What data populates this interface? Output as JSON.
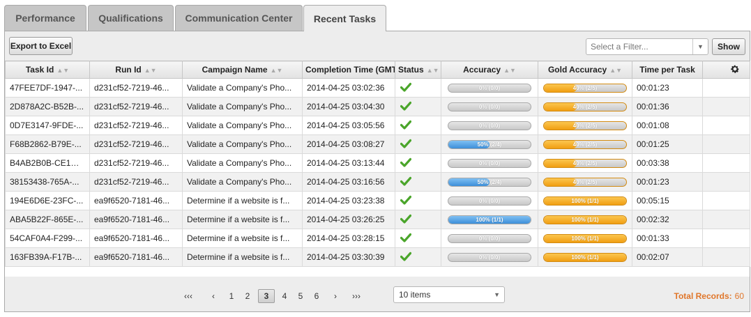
{
  "tabs": [
    {
      "label": "Performance"
    },
    {
      "label": "Qualifications"
    },
    {
      "label": "Communication Center"
    },
    {
      "label": "Recent Tasks"
    }
  ],
  "toolbar": {
    "export_label": "Export to Excel",
    "filter_placeholder": "Select a Filter...",
    "show_label": "Show"
  },
  "columns": [
    "Task Id",
    "Run Id",
    "Campaign Name",
    "Completion Time (GMT)",
    "Status",
    "Accuracy",
    "Gold Accuracy",
    "Time per Task"
  ],
  "rows": [
    {
      "task_id": "47FEE7DF-1947-...",
      "run_id": "d231cf52-7219-46...",
      "campaign": "Validate a Company's Pho...",
      "time": "2014-04-25 03:02:36",
      "acc": "0% (0/0)",
      "acc_pct": 0,
      "gold": "40% (2/5)",
      "gold_pct": 40,
      "tpt": "00:01:23"
    },
    {
      "task_id": "2D878A2C-B52B-...",
      "run_id": "d231cf52-7219-46...",
      "campaign": "Validate a Company's Pho...",
      "time": "2014-04-25 03:04:30",
      "acc": "0% (0/0)",
      "acc_pct": 0,
      "gold": "40% (2/5)",
      "gold_pct": 40,
      "tpt": "00:01:36"
    },
    {
      "task_id": "0D7E3147-9FDE-...",
      "run_id": "d231cf52-7219-46...",
      "campaign": "Validate a Company's Pho...",
      "time": "2014-04-25 03:05:56",
      "acc": "0% (0/0)",
      "acc_pct": 0,
      "gold": "40% (2/5)",
      "gold_pct": 40,
      "tpt": "00:01:08"
    },
    {
      "task_id": "F68B2862-B79E-...",
      "run_id": "d231cf52-7219-46...",
      "campaign": "Validate a Company's Pho...",
      "time": "2014-04-25 03:08:27",
      "acc": "50% (2/4)",
      "acc_pct": 50,
      "gold": "40% (2/5)",
      "gold_pct": 40,
      "tpt": "00:01:25"
    },
    {
      "task_id": "B4AB2B0B-CE1D-...",
      "run_id": "d231cf52-7219-46...",
      "campaign": "Validate a Company's Pho...",
      "time": "2014-04-25 03:13:44",
      "acc": "0% (0/0)",
      "acc_pct": 0,
      "gold": "40% (2/5)",
      "gold_pct": 40,
      "tpt": "00:03:38"
    },
    {
      "task_id": "38153438-765A-...",
      "run_id": "d231cf52-7219-46...",
      "campaign": "Validate a Company's Pho...",
      "time": "2014-04-25 03:16:56",
      "acc": "50% (2/4)",
      "acc_pct": 50,
      "gold": "40% (2/5)",
      "gold_pct": 40,
      "tpt": "00:01:23"
    },
    {
      "task_id": "194E6D6E-23FC-...",
      "run_id": "ea9f6520-7181-46...",
      "campaign": "Determine if a website is f...",
      "time": "2014-04-25 03:23:38",
      "acc": "0% (0/0)",
      "acc_pct": 0,
      "gold": "100% (1/1)",
      "gold_pct": 100,
      "tpt": "00:05:15"
    },
    {
      "task_id": "ABA5B22F-865E-...",
      "run_id": "ea9f6520-7181-46...",
      "campaign": "Determine if a website is f...",
      "time": "2014-04-25 03:26:25",
      "acc": "100% (1/1)",
      "acc_pct": 100,
      "gold": "100% (1/1)",
      "gold_pct": 100,
      "tpt": "00:02:32"
    },
    {
      "task_id": "54CAF0A4-F299-...",
      "run_id": "ea9f6520-7181-46...",
      "campaign": "Determine if a website is f...",
      "time": "2014-04-25 03:28:15",
      "acc": "0% (0/0)",
      "acc_pct": 0,
      "gold": "100% (1/1)",
      "gold_pct": 100,
      "tpt": "00:01:33"
    },
    {
      "task_id": "163FB39A-F17B-...",
      "run_id": "ea9f6520-7181-46...",
      "campaign": "Determine if a website is f...",
      "time": "2014-04-25 03:30:39",
      "acc": "0% (0/0)",
      "acc_pct": 0,
      "gold": "100% (1/1)",
      "gold_pct": 100,
      "tpt": "00:02:07"
    }
  ],
  "pager": {
    "first": "‹‹‹",
    "prev": "‹",
    "pages": [
      "1",
      "2",
      "3",
      "4",
      "5",
      "6"
    ],
    "current_page": "3",
    "next": "›",
    "last": "›››",
    "page_size": "10 items",
    "total_label": "Total Records:",
    "total_value": "60"
  },
  "colors": {
    "accent_orange": "#e0762a",
    "bar_blue": "#3d8fd9",
    "bar_gold": "#f19e12",
    "check_green": "#4aa52a"
  },
  "icons": {
    "status": "check-icon",
    "settings": "gear-icon",
    "sort": "sort-arrows-icon"
  }
}
